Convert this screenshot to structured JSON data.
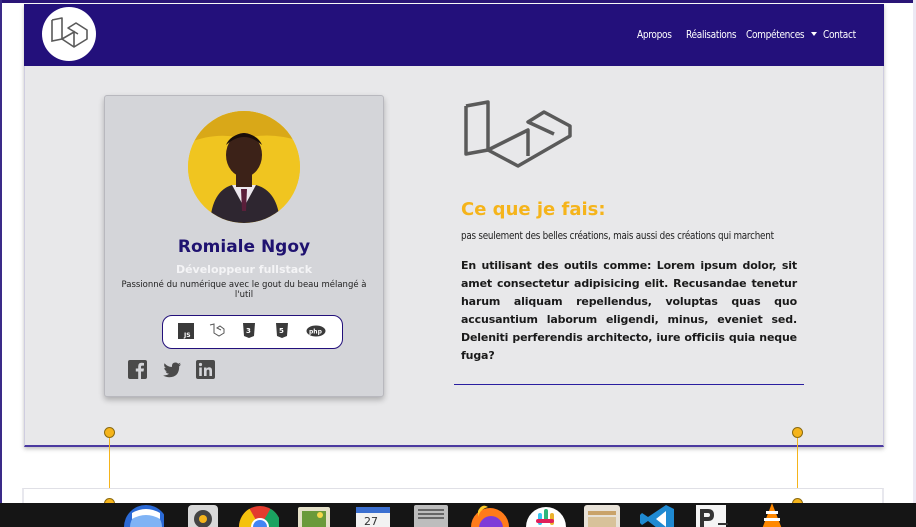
{
  "navbar": {
    "logo_icon": "laravel-icon",
    "links": [
      {
        "label": "Apropos"
      },
      {
        "label": "Réalisations"
      },
      {
        "label": "Compétences",
        "has_dropdown": true
      },
      {
        "label": "Contact"
      }
    ],
    "background": "#23107b"
  },
  "profile": {
    "avatar_icon": "avatar-photo",
    "name": "Romiale Ngoy",
    "role": "Développeur fullstack",
    "description": "Passionné du numérique avec le gout du beau mélangé à l'util",
    "tech_icons": [
      "js-icon",
      "laravel-icon",
      "css3-icon",
      "html5-icon",
      "php-icon"
    ],
    "social_icons": [
      "facebook-icon",
      "twitter-icon",
      "linkedin-icon"
    ]
  },
  "services": {
    "logo_icon": "laravel-icon",
    "title": "Ce que je fais:",
    "subtitle": "pas seulement des belles créations, mais aussi des créations qui marchent",
    "body": "En utilisant des outils comme: Lorem ipsum dolor, sit amet consectetur adipisicing elit. Recusandae tenetur harum aliquam repellendus, voluptas quas quo accusantium laborum eligendi, minus, eveniet sed. Deleniti perferendis architecto, iure officiis quia neque fuga?"
  },
  "taskbar": {
    "apps": [
      "thunderbird-icon",
      "rhythmbox-icon",
      "chrome-icon",
      "photos-icon",
      "calendar-icon",
      "spreadsheet-icon",
      "firefox-icon",
      "slack-icon",
      "files-icon",
      "vscode-icon",
      "text-editor-icon",
      "vlc-icon"
    ],
    "calendar_day": "27"
  },
  "colors": {
    "brand": "#23107b",
    "accent": "#f5b41b",
    "card": "#d4d5d9"
  }
}
